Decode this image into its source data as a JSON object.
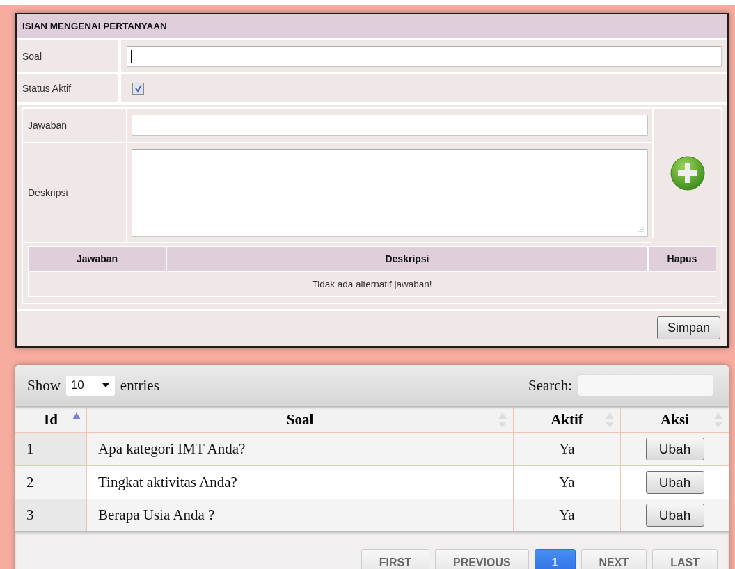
{
  "form": {
    "title": "ISIAN MENGENAI PERTANYAAN",
    "soal": {
      "label": "Soal"
    },
    "status": {
      "label": "Status Aktif",
      "checked": true
    },
    "answer": {
      "jawaban_label": "Jawaban",
      "deskripsi_label": "Deskripsi",
      "columns": [
        "Jawaban",
        "Deskripsi",
        "Hapus"
      ],
      "empty_message": "Tidak ada alternatif jawaban!"
    },
    "save_button": "Simpan"
  },
  "list": {
    "show_label": "Show",
    "page_size": "10",
    "entries_label": "entries",
    "search_label": "Search:",
    "columns": [
      {
        "label": "Id",
        "sorted": true
      },
      {
        "label": "Soal",
        "sorted": false
      },
      {
        "label": "Aktif",
        "sorted": false
      },
      {
        "label": "Aksi",
        "sorted": false
      }
    ],
    "rows": [
      {
        "id": "1",
        "soal": "Apa kategori IMT Anda?",
        "aktif": "Ya",
        "action": "Ubah"
      },
      {
        "id": "2",
        "soal": "Tingkat aktivitas Anda?",
        "aktif": "Ya",
        "action": "Ubah"
      },
      {
        "id": "3",
        "soal": "Berapa Usia Anda ?",
        "aktif": "Ya",
        "action": "Ubah"
      }
    ],
    "pagination": [
      {
        "label": "FIRST",
        "selected": false
      },
      {
        "label": "PREVIOUS",
        "selected": false
      },
      {
        "label": "1",
        "selected": true
      },
      {
        "label": "NEXT",
        "selected": false
      },
      {
        "label": "LAST",
        "selected": false
      }
    ]
  }
}
